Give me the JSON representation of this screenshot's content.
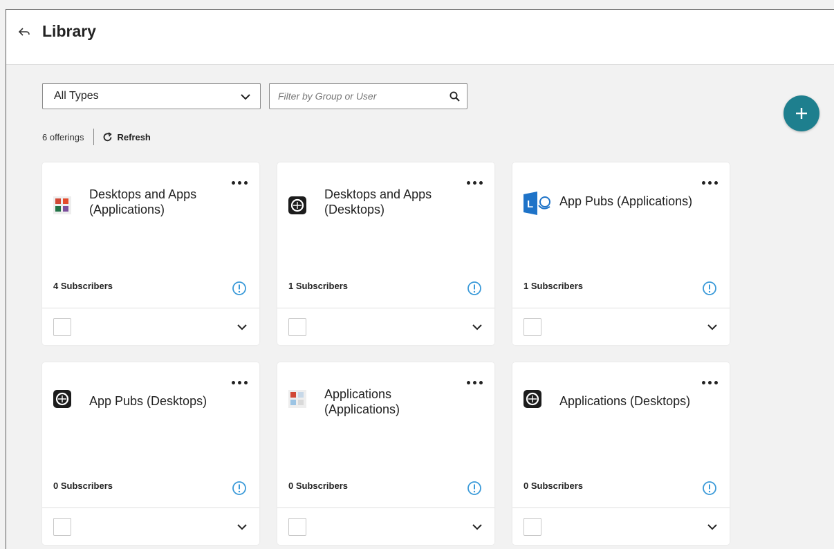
{
  "header": {
    "title": "Library"
  },
  "filters": {
    "type_select_value": "All Types",
    "search_placeholder": "Filter by Group or User"
  },
  "summary": {
    "offerings_count": "6 offerings",
    "refresh_label": "Refresh"
  },
  "colors": {
    "accent": "#1e7f8e",
    "info": "#3a9ad9"
  },
  "cards": [
    {
      "title_line1": "Desktops and Apps",
      "title_line2": "(Applications)",
      "subscribers": "4 Subscribers",
      "icon": "office-apps-icon"
    },
    {
      "title_line1": "Desktops and Apps",
      "title_line2": "(Desktops)",
      "subscribers": "1 Subscribers",
      "icon": "windows-desktop-icon"
    },
    {
      "title_line1": "App Pubs (Applications)",
      "title_line2": "",
      "subscribers": "1 Subscribers",
      "icon": "lync-icon"
    },
    {
      "title_line1": "App Pubs (Desktops)",
      "title_line2": "",
      "subscribers": "0 Subscribers",
      "icon": "windows-desktop-icon"
    },
    {
      "title_line1": "Applications",
      "title_line2": "(Applications)",
      "subscribers": "0 Subscribers",
      "icon": "office-apps-icon"
    },
    {
      "title_line1": "Applications (Desktops)",
      "title_line2": "",
      "subscribers": "0 Subscribers",
      "icon": "windows-desktop-icon"
    }
  ]
}
